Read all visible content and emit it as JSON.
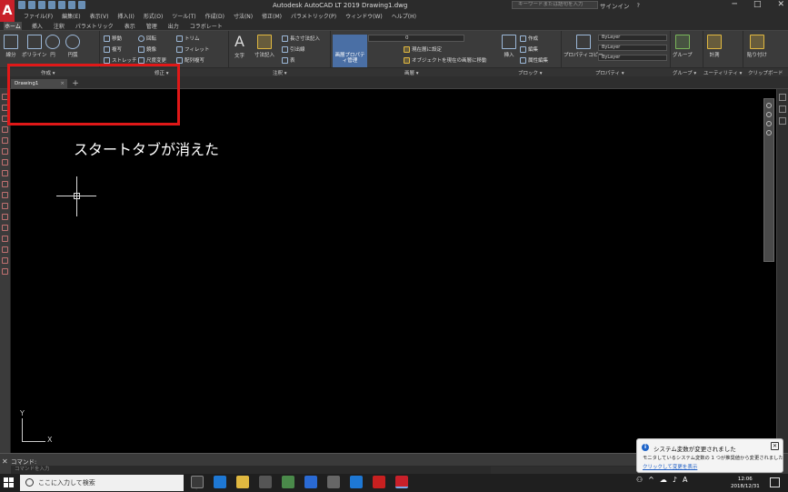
{
  "window": {
    "app_logo": "A",
    "title": "Autodesk AutoCAD LT 2019    Drawing1.dwg",
    "search_placeholder": "キーワードまたは語句を入力",
    "sign_in": "サインイン",
    "help": "?",
    "minimize": "─",
    "maximize": "□",
    "close": "✕"
  },
  "menu": [
    "ファイル(F)",
    "編集(E)",
    "表示(V)",
    "挿入(I)",
    "形式(O)",
    "ツール(T)",
    "作成(D)",
    "寸法(N)",
    "修正(M)",
    "パラメトリック(P)",
    "ウィンドウ(W)",
    "ヘルプ(H)"
  ],
  "ribbon_tabs": [
    "ホーム",
    "挿入",
    "注釈",
    "パラメトリック",
    "表示",
    "管理",
    "出力",
    "コラボレート"
  ],
  "ribbon": {
    "draw": {
      "line": "線分",
      "polyline": "ポリライン",
      "circle": "円",
      "arc": "円弧"
    },
    "modify": {
      "move": "移動",
      "rotate": "回転",
      "trim": "トリム",
      "copy": "複写",
      "mirror": "鏡像",
      "fillet": "フィレット",
      "stretch": "ストレッチ",
      "scale": "尺度変更",
      "array": "配列複写"
    },
    "annotation": {
      "text": "文字",
      "dimension": "寸法記入",
      "linear": "長さ寸法記入",
      "leader": "引出線",
      "table": "表"
    },
    "layers": {
      "manage": "画層プロパティ管理",
      "current": "0",
      "set_current": "現在層に設定",
      "match": "オブジェクトを現在の画層に移動"
    },
    "block": {
      "insert": "挿入",
      "create": "作成",
      "edit": "編集",
      "attr": "属性編集"
    },
    "properties": {
      "match": "プロパティコピー",
      "bylayer1": "ByLayer",
      "bylayer2": "ByLayer",
      "bylayer3": "ByLayer"
    },
    "groups": {
      "group": "グループ"
    },
    "utilities": {
      "measure": "計測"
    },
    "clipboard": {
      "paste": "貼り付け"
    }
  },
  "panel_labels": [
    "作成 ▾",
    "修正 ▾",
    "注釈 ▾",
    "画層 ▾",
    "ブロック ▾",
    "プロパティ ▾",
    "グループ ▾",
    "ユーティリティ ▾",
    "クリップボード"
  ],
  "doc_tabs": {
    "active": "Drawing1",
    "close": "×",
    "new": "+"
  },
  "annotation_text": "スタートタブが消えた",
  "ucs": {
    "y": "Y",
    "x": "X"
  },
  "command": {
    "prompt": "コマンド:",
    "placeholder": "コマンドを入力"
  },
  "notification": {
    "title": "システム変数が変更されました",
    "body": "モニタしているシステム変数の 1 つが推奨値から変更されました",
    "link": "クリックして変更を表示",
    "close": "✕"
  },
  "taskbar": {
    "search": "ここに入力して検索",
    "ime": "A",
    "time": "12:06",
    "date": "2018/12/31"
  },
  "colors": {
    "accent": "#4a6fa5",
    "highlight": "#e01818",
    "logo": "#c8202a"
  }
}
